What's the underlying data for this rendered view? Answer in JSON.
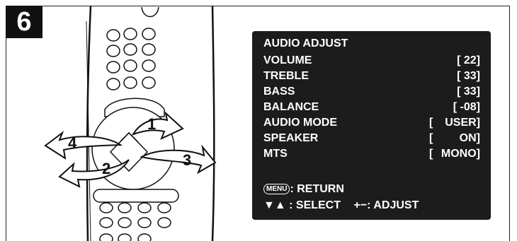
{
  "step": "6",
  "remote": {
    "arrow_labels": [
      "1",
      "2",
      "3",
      "4"
    ]
  },
  "osd": {
    "title": "AUDIO ADJUST",
    "rows": [
      {
        "label": "VOLUME",
        "value": "[  22]"
      },
      {
        "label": "TREBLE",
        "value": "[  33]"
      },
      {
        "label": "BASS",
        "value": "[  33]"
      },
      {
        "label": "BALANCE",
        "value": "[ -08]"
      },
      {
        "label": "AUDIO MODE",
        "open": "[",
        "value": "USER]"
      },
      {
        "label": "SPEAKER",
        "open": "[",
        "value": "ON]"
      },
      {
        "label": "MTS",
        "open": "[",
        "value": "MONO]"
      }
    ],
    "footer": {
      "menu_key": "MENU",
      "return_text": ": RETURN",
      "select_glyph": "▼▲",
      "select_text": " : SELECT",
      "adjust_glyph": "+−",
      "adjust_text": ": ADJUST"
    }
  }
}
